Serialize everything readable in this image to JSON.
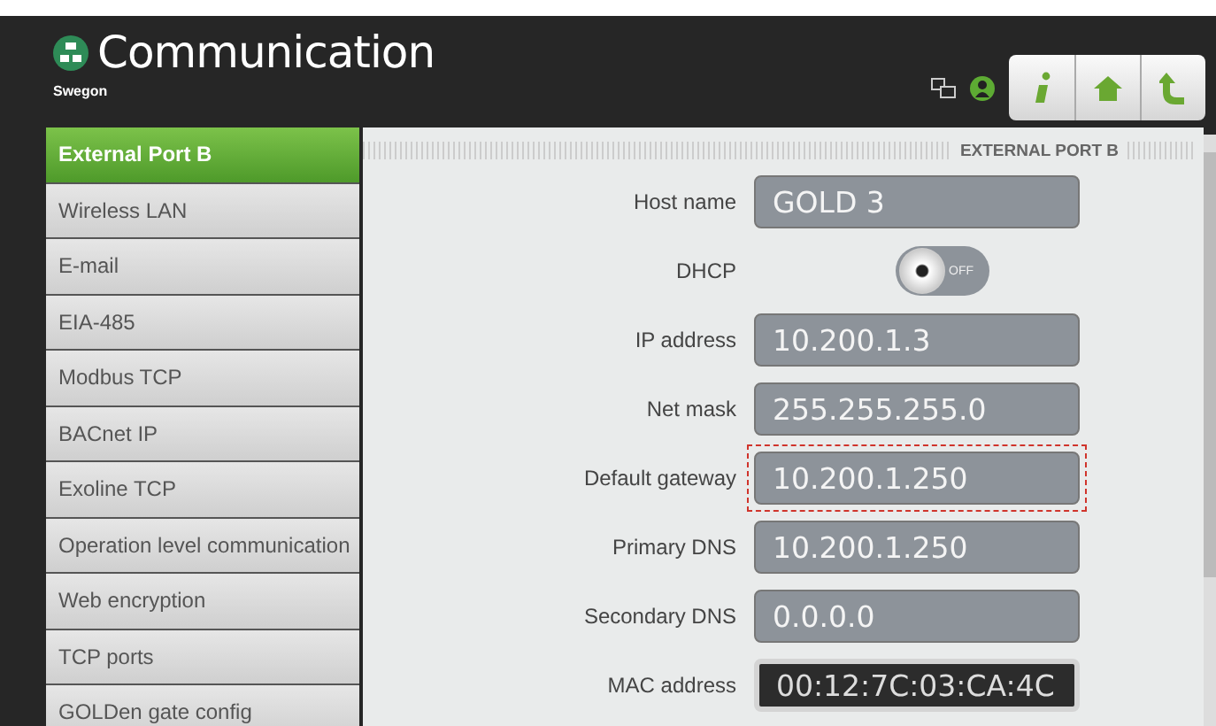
{
  "header": {
    "title": "Communication",
    "brand": "Swegon"
  },
  "sidebar": {
    "items": [
      {
        "label": "External Port B",
        "selected": true
      },
      {
        "label": "Wireless LAN",
        "selected": false
      },
      {
        "label": "E-mail",
        "selected": false
      },
      {
        "label": "EIA-485",
        "selected": false
      },
      {
        "label": "Modbus TCP",
        "selected": false
      },
      {
        "label": "BACnet IP",
        "selected": false
      },
      {
        "label": "Exoline TCP",
        "selected": false
      },
      {
        "label": "Operation level communication",
        "selected": false
      },
      {
        "label": "Web encryption",
        "selected": false
      },
      {
        "label": "TCP ports",
        "selected": false
      },
      {
        "label": "GOLDen gate config",
        "selected": false
      }
    ]
  },
  "section_title": "EXTERNAL PORT B",
  "fields": [
    {
      "kind": "input",
      "label": "Host name",
      "value": "GOLD 3",
      "highlighted": false
    },
    {
      "kind": "toggle",
      "label": "DHCP",
      "on": false,
      "state_text": "OFF"
    },
    {
      "kind": "input",
      "label": "IP address",
      "value": "10.200.1.3",
      "highlighted": false
    },
    {
      "kind": "input",
      "label": "Net mask",
      "value": "255.255.255.0",
      "highlighted": false
    },
    {
      "kind": "input",
      "label": "Default gateway",
      "value": "10.200.1.250",
      "highlighted": true
    },
    {
      "kind": "input",
      "label": "Primary DNS",
      "value": "10.200.1.250",
      "highlighted": false
    },
    {
      "kind": "input",
      "label": "Secondary DNS",
      "value": "0.0.0.0",
      "highlighted": false
    },
    {
      "kind": "readonly",
      "label": "MAC address",
      "value": "00:12:7C:03:CA:4C",
      "highlighted": false
    }
  ]
}
